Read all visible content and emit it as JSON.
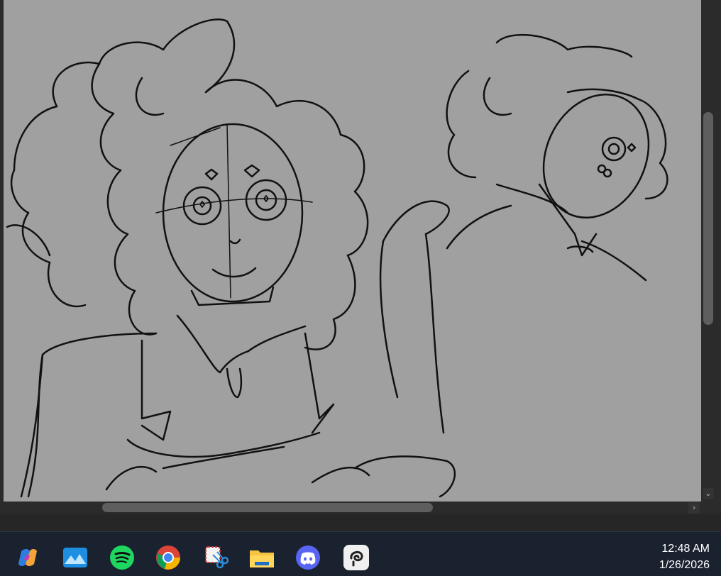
{
  "taskbar": {
    "icons": [
      "copilot-icon",
      "photos-icon",
      "spotify-icon",
      "chrome-icon",
      "snipping-tool-icon",
      "file-explorer-icon",
      "discord-icon",
      "clip-studio-icon"
    ],
    "clock": {
      "time": "12:48 AM",
      "date": "1/26/2026"
    }
  },
  "colors": {
    "canvas": "#a0a0a0",
    "taskbar": "#1a2230",
    "chrome": "#2b2b2b"
  }
}
